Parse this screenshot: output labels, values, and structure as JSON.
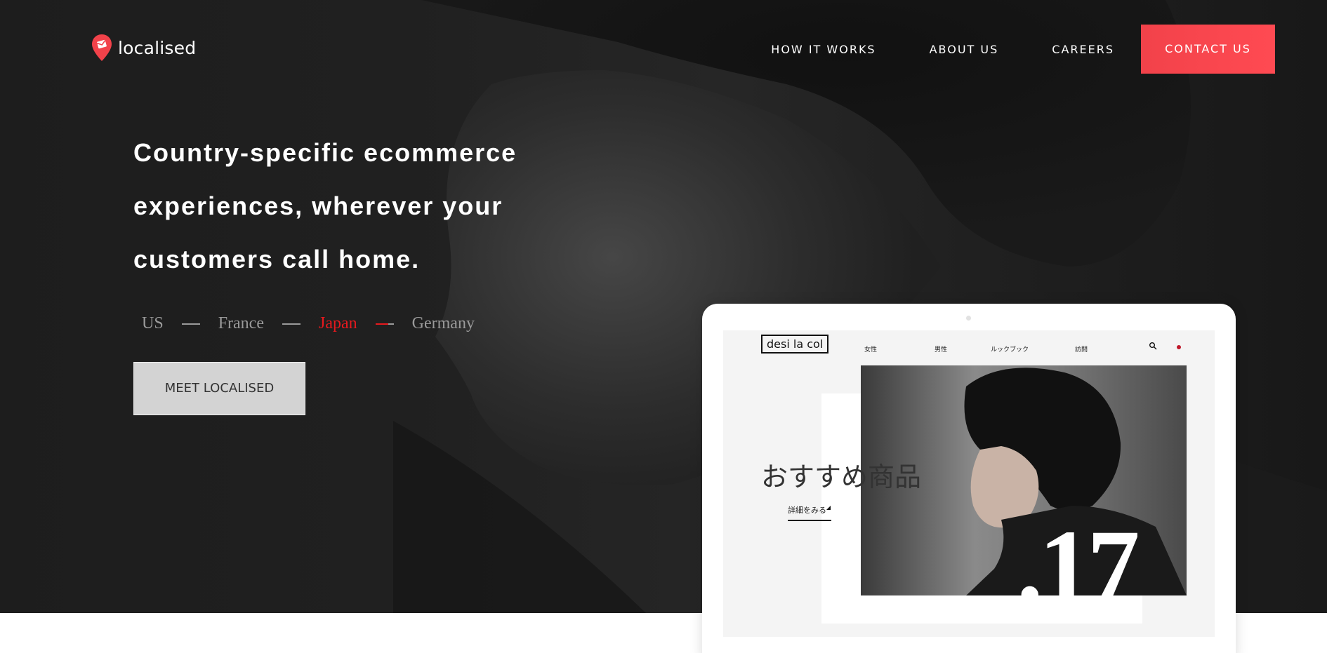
{
  "brand": {
    "name": "localised",
    "accent": "#f2424a"
  },
  "nav": {
    "items": [
      "HOW IT WORKS",
      "ABOUT US",
      "CAREERS"
    ],
    "cta": "CONTACT US"
  },
  "hero": {
    "headline_lines": [
      "Country-specific ecommerce",
      "experiences, wherever your",
      "customers call home."
    ],
    "countries": [
      "US",
      "France",
      "Japan",
      "Germany"
    ],
    "active_country": "Japan",
    "active_color": "#e8191e",
    "button": "MEET LOCALISED"
  },
  "mockup": {
    "site_logo": "desi la col",
    "nav_items": [
      "女性",
      "男性",
      "ルックブック",
      "訪問"
    ],
    "icons": [
      "search-icon",
      "cart-dot-icon"
    ],
    "heading": "おすすめ商品",
    "link": "詳細をみる",
    "badge_number": ".17"
  }
}
